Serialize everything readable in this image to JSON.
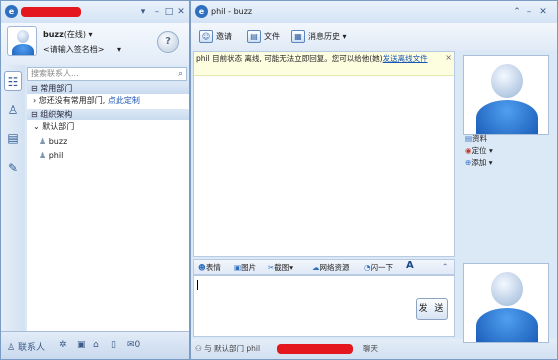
{
  "left": {
    "status_label": "(在线)",
    "username": "buzz",
    "signature_placeholder": "<请输入签名档>",
    "search_placeholder": "搜索联系人...",
    "groups": [
      {
        "label": "常用部门",
        "hint": "您还没有常用部门,",
        "hint_link": "点此定制"
      },
      {
        "label": "组织架构",
        "subgroup": "默认部门",
        "members": [
          "buzz",
          "phil"
        ]
      }
    ],
    "bottom_contacts": "联系人"
  },
  "chat": {
    "title": "phil - buzz",
    "toolbar": {
      "invite": "邀请",
      "file": "文件",
      "history": "消息历史"
    },
    "notice_text": "phil 目前状态 离线, 可能无法立即回复。您可以给他(她)",
    "notice_link": "发送离线文件",
    "input_tools": {
      "emoji": "表情",
      "picture": "图片",
      "screenshot": "截图",
      "netres": "网络资源",
      "flash": "闪一下",
      "font": "A"
    },
    "send_label": "发 送",
    "status_prefix": "与 默认部门 phil",
    "status_suffix": "聊天"
  },
  "side": {
    "profile": "资料",
    "locate": "定位",
    "add": "添加"
  }
}
